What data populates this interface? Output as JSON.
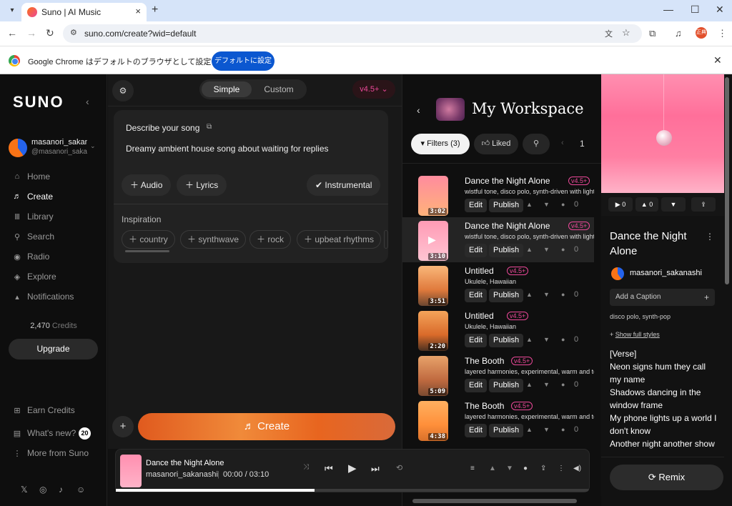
{
  "browser": {
    "tab_title": "Suno | AI Music",
    "url": "suno.com/create?wid=default",
    "profile_label": "正典",
    "infobar_message": "Google Chrome はデフォルトのブラウザとして設定されていません",
    "infobar_button": "デフォルトに設定"
  },
  "sidebar": {
    "logo": "SUNO",
    "user_name": "masanori_sakanashi",
    "user_handle": "@masanori_sakanashi",
    "nav": [
      {
        "label": "Home",
        "icon": "home-icon"
      },
      {
        "label": "Create",
        "icon": "create-icon"
      },
      {
        "label": "Library",
        "icon": "library-icon"
      },
      {
        "label": "Search",
        "icon": "search-icon"
      },
      {
        "label": "Radio",
        "icon": "radio-icon"
      },
      {
        "label": "Explore",
        "icon": "explore-icon"
      },
      {
        "label": "Notifications",
        "icon": "bell-icon"
      }
    ],
    "credits_value": "2,470",
    "credits_label": "Credits",
    "upgrade": "Upgrade",
    "earn_credits": "Earn Credits",
    "whats_new": "What's new?",
    "whats_new_count": "20",
    "more": "More from Suno"
  },
  "create": {
    "mode_simple": "Simple",
    "mode_custom": "Custom",
    "version": "v4.5+",
    "describe_label": "Describe your song",
    "prompt": "Dreamy ambient house song about waiting for replies",
    "audio": "Audio",
    "lyrics": "Lyrics",
    "instrumental": "Instrumental",
    "inspiration_label": "Inspiration",
    "tags": [
      "country",
      "synthwave",
      "rock",
      "upbeat rhythms"
    ],
    "create_button": "Create"
  },
  "workspace": {
    "title": "My Workspace",
    "filters": "Filters (3)",
    "liked": "Liked",
    "page": "1",
    "edit": "Edit",
    "publish": "Publish",
    "songs": [
      {
        "title": "Dance the Night Alone",
        "badge": "v4.5+",
        "style": "wistful tone, disco polo, synth-driven with light d",
        "duration": "3:02",
        "count": "0"
      },
      {
        "title": "Dance the Night Alone",
        "badge": "v4.5+",
        "style": "wistful tone, disco polo, synth-driven with light d",
        "duration": "3:10",
        "count": "0"
      },
      {
        "title": "Untitled",
        "badge": "v4.5+",
        "style": "Ukulele, Hawaiian",
        "duration": "3:51",
        "count": "0"
      },
      {
        "title": "Untitled",
        "badge": "v4.5+",
        "style": "Ukulele, Hawaiian",
        "duration": "2:20",
        "count": "0"
      },
      {
        "title": "The Booth",
        "badge": "v4.5+",
        "style": "layered harmonies, experimental, warm and text",
        "duration": "5:09",
        "count": "0"
      },
      {
        "title": "The Booth",
        "badge": "v4.5+",
        "style": "layered harmonies, experimental, warm and text",
        "duration": "4:38",
        "count": "0"
      }
    ]
  },
  "detail": {
    "play_count": "0",
    "like_count": "0",
    "title": "Dance the Night Alone",
    "artist": "masanori_sakanashi",
    "caption": "Add a Caption",
    "styles": "disco polo, synth-pop",
    "show_full": "Show full styles",
    "lyrics": [
      "[Verse]",
      "Neon signs hum they call my name",
      "Shadows dancing in the window frame",
      "My phone lights up a world I don't know",
      "Another night another show"
    ],
    "remix": "Remix"
  },
  "player": {
    "title": "Dance the Night Alone",
    "artist": "masanori_sakanashi",
    "time": "00:00 /  03:10",
    "progress": 0.42
  }
}
